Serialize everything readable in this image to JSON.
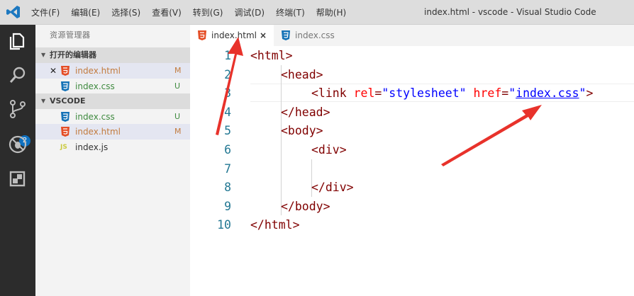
{
  "titlebar": {
    "menu": [
      "文件(F)",
      "编辑(E)",
      "选择(S)",
      "查看(V)",
      "转到(G)",
      "调试(D)",
      "终端(T)",
      "帮助(H)"
    ],
    "window_title": "index.html - vscode - Visual Studio Code"
  },
  "activitybar": {
    "icons": [
      "explorer-icon",
      "search-icon",
      "source-control-icon",
      "debug-icon",
      "extensions-icon"
    ],
    "scm_badge": "2"
  },
  "sidebar": {
    "title": "资源管理器",
    "open_editors": {
      "header": "打开的编辑器",
      "items": [
        {
          "name": "index.html",
          "status": "M",
          "icon": "html5-icon"
        },
        {
          "name": "index.css",
          "status": "U",
          "icon": "css3-icon"
        }
      ]
    },
    "folder": {
      "header": "VSCODE",
      "items": [
        {
          "name": "index.css",
          "status": "U",
          "icon": "css3-icon"
        },
        {
          "name": "index.html",
          "status": "M",
          "icon": "html5-icon"
        },
        {
          "name": "index.js",
          "status": "",
          "icon": "JS"
        }
      ]
    }
  },
  "tabs": [
    {
      "label": "index.html",
      "close": "×",
      "icon": "html5-icon"
    },
    {
      "label": "index.css",
      "icon": "css3-icon"
    }
  ],
  "editor": {
    "line_numbers": [
      "1",
      "2",
      "3",
      "4",
      "5",
      "6",
      "7",
      "8",
      "9",
      "10"
    ],
    "lines": [
      {
        "tag_open": "<html>"
      },
      {
        "tag_open": "<head>"
      },
      {
        "t1": "<link ",
        "a1": "rel",
        "eq1": "=",
        "s1": "\"stylesheet\"",
        "sp": " ",
        "a2": "href",
        "eq2": "=",
        "q1": "\"",
        "link": "index.css",
        "q2": "\"",
        "t2": ">"
      },
      {
        "tag_open": "</head>"
      },
      {
        "tag_open": "<body>"
      },
      {
        "tag_open": "<div>"
      },
      {
        "tag_open": ""
      },
      {
        "tag_open": "</div>"
      },
      {
        "tag_open": "</body>"
      },
      {
        "tag_open": "</html>"
      }
    ]
  },
  "colors": {
    "accent_red_arrow": "#e8322b",
    "html_icon": "#e44d26",
    "css_icon": "#1572b6",
    "modified": "#c27b3e",
    "untracked": "#3f8a3f"
  }
}
